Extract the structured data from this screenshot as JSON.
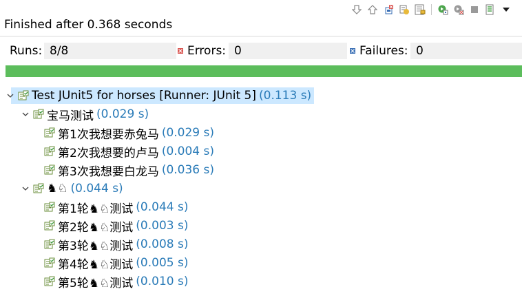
{
  "toolbar": {
    "buttons": [
      {
        "icon": "next-failure-icon"
      },
      {
        "icon": "previous-failure-icon"
      },
      {
        "icon": "show-failures-only-icon"
      },
      {
        "icon": "show-skipped-only-icon"
      },
      {
        "icon": "scroll-lock-icon"
      },
      {
        "icon": "rerun-test-icon"
      },
      {
        "icon": "rerun-failed-first-icon"
      },
      {
        "icon": "stop-icon"
      },
      {
        "icon": "test-run-history-icon"
      },
      {
        "icon": "view-menu-icon"
      }
    ]
  },
  "status": {
    "finished_text": "Finished after 0.368 seconds"
  },
  "counters": {
    "runs_label": "Runs:",
    "runs_value": "8/8",
    "errors_label": "Errors:",
    "errors_value": "0",
    "failures_label": "Failures:",
    "failures_value": "0"
  },
  "progress": {
    "fraction": 1.0,
    "color": "#5cbd5c"
  },
  "tree": {
    "root": {
      "name": "Test JUnit5 for horses [Runner: JUnit 5]",
      "time": "(0.113 s)"
    },
    "group1": {
      "name": "宝马测试",
      "time": "(0.029 s)"
    },
    "g1_items": [
      {
        "name": "第1次我想要赤兔马",
        "time": "(0.029 s)"
      },
      {
        "name": "第2次我想要的卢马",
        "time": "(0.004 s)"
      },
      {
        "name": "第3次我想要白龙马",
        "time": "(0.036 s)"
      }
    ],
    "group2": {
      "name": "♞♘",
      "time": "(0.044 s)"
    },
    "g2_items": [
      {
        "name": "第1轮♞♘测试",
        "time": "(0.044 s)"
      },
      {
        "name": "第2轮♞♘测试",
        "time": "(0.003 s)"
      },
      {
        "name": "第3轮♞♘测试",
        "time": "(0.008 s)"
      },
      {
        "name": "第4轮♞♘测试",
        "time": "(0.005 s)"
      },
      {
        "name": "第5轮♞♘测试",
        "time": "(0.010 s)"
      }
    ]
  },
  "colors": {
    "time_text": "#2a7bb8",
    "selection": "#cce8ff",
    "success_green": "#5cbd5c",
    "error_red": "#d9534f",
    "failure_blue": "#3a6fb5"
  }
}
